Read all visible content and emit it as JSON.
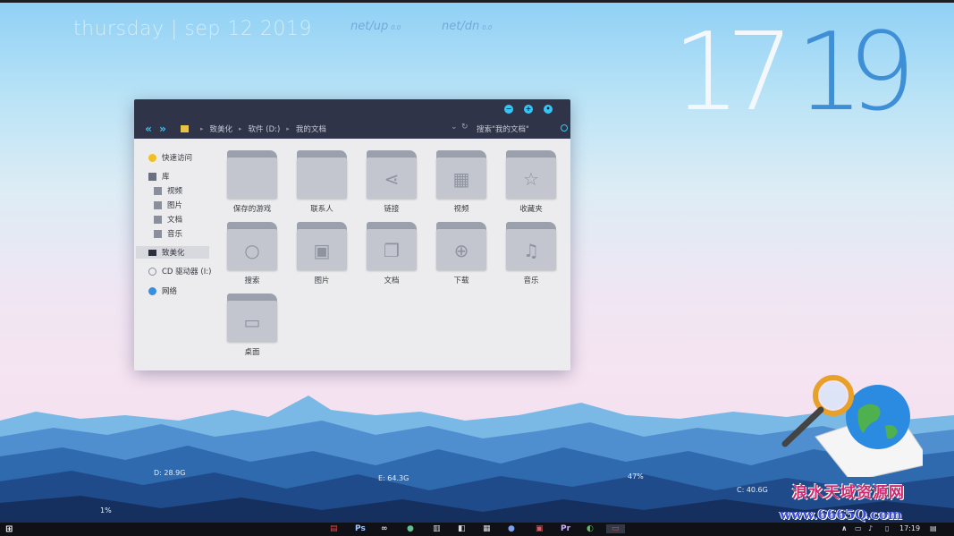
{
  "desktop": {
    "date": "thursday | sep 12 2019",
    "net_up_label": "net/up",
    "net_up_value": "0.0",
    "net_dn_label": "net/dn",
    "net_dn_value": "0.0",
    "clock_digits": [
      "1",
      "7",
      "1",
      "9"
    ],
    "disks": [
      {
        "label": "D: 28.9G"
      },
      {
        "label": "E: 64.3G"
      },
      {
        "label": "47%"
      },
      {
        "label": "C: 40.6G"
      },
      {
        "label": "1%"
      }
    ]
  },
  "window": {
    "breadcrumb": [
      "致美化",
      "软件 (D:)",
      "我的文档"
    ],
    "search_placeholder": "搜索\"我的文档\"",
    "controls": {
      "minimize": "−",
      "maximize": "+",
      "close": "•"
    },
    "sidebar": [
      {
        "label": "快速访问",
        "icon": "star-icon"
      },
      {
        "label": "库",
        "icon": "library-icon"
      },
      {
        "label": "视频",
        "icon": "video-icon"
      },
      {
        "label": "图片",
        "icon": "pictures-icon"
      },
      {
        "label": "文档",
        "icon": "documents-icon"
      },
      {
        "label": "音乐",
        "icon": "music-icon"
      },
      {
        "label": "致美化",
        "icon": "computer-icon"
      },
      {
        "label": "CD 驱动器 (I:)",
        "icon": "cd-drive-icon"
      },
      {
        "label": "网络",
        "icon": "network-icon"
      }
    ],
    "items": [
      {
        "label": "保存的游戏",
        "icon": "games-folder-icon"
      },
      {
        "label": "联系人",
        "icon": "contacts-folder-icon"
      },
      {
        "label": "链接",
        "icon": "share-folder-icon"
      },
      {
        "label": "视频",
        "icon": "video-folder-icon"
      },
      {
        "label": "收藏夹",
        "icon": "star-folder-icon"
      },
      {
        "label": "搜索",
        "icon": "search-folder-icon"
      },
      {
        "label": "图片",
        "icon": "pictures-folder-icon"
      },
      {
        "label": "文档",
        "icon": "documents-folder-icon"
      },
      {
        "label": "下载",
        "icon": "download-folder-icon"
      },
      {
        "label": "音乐",
        "icon": "music-folder-icon"
      },
      {
        "label": "桌面",
        "icon": "desktop-folder-icon"
      }
    ]
  },
  "taskbar": {
    "apps": [
      "Ps",
      "Pr"
    ],
    "time": "17:19"
  },
  "watermark": {
    "text": "浪水天域资源网",
    "url": "www.6665Q.com"
  },
  "colors": {
    "accent": "#36c6f5",
    "titlebar": "#2f3448"
  }
}
